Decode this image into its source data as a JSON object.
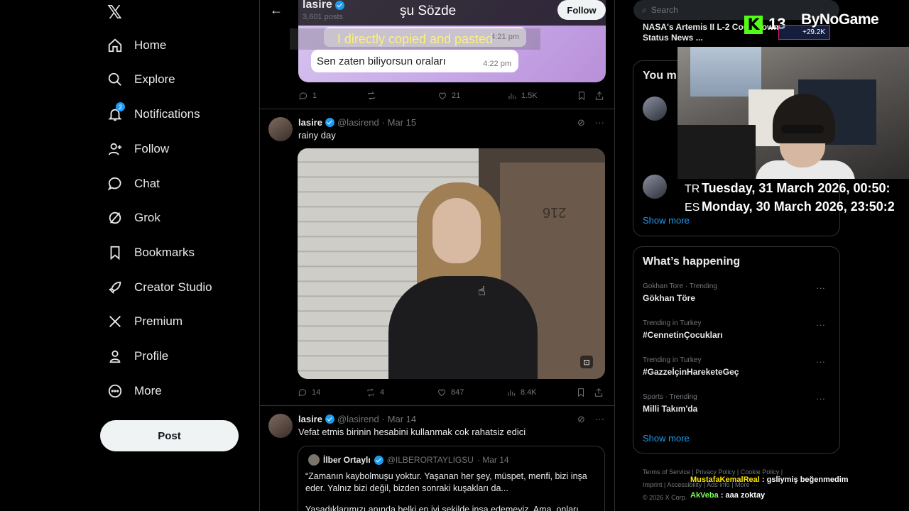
{
  "nav": {
    "logo": "𝕏",
    "items": [
      {
        "label": "Home"
      },
      {
        "label": "Explore"
      },
      {
        "label": "Notifications",
        "badge": "2"
      },
      {
        "label": "Follow"
      },
      {
        "label": "Chat"
      },
      {
        "label": "Grok"
      },
      {
        "label": "Bookmarks"
      },
      {
        "label": "Creator Studio"
      },
      {
        "label": "Premium"
      },
      {
        "label": "Profile"
      },
      {
        "label": "More"
      }
    ],
    "post_label": "Post"
  },
  "feed": {
    "header": {
      "name": "lasire",
      "posts_count": "3,601 posts",
      "follow_label": "Follow"
    },
    "overlay_subtitle": "şu Sözde",
    "overlay_caption": "I directly copied and pasted",
    "tweet1": {
      "chat_message": "Sen zaten biliyorsun oraları",
      "chat_time": "4:22 pm",
      "chat_time_top": "4:21 pm",
      "replies": "1",
      "reposts": "",
      "likes": "21",
      "views": "1.5K"
    },
    "tweet2": {
      "name": "lasire",
      "handle": "@lasirend",
      "date": "· Mar 15",
      "text": "rainy day",
      "door_number": "216",
      "replies": "14",
      "reposts": "4",
      "likes": "847",
      "views": "8.4K"
    },
    "tweet3": {
      "name": "lasire",
      "handle": "@lasirend",
      "date": "· Mar 14",
      "text": "Vefat etmis birinin hesabini kullanmak cok rahatsiz edici",
      "quote": {
        "name": "İlber Ortaylı",
        "handle": "@ILBERORTAYLIGSU",
        "date": "· Mar 14",
        "text": "“Zamanın kaybolmuşu yoktur. Yaşanan her şey, müspet, menfi, bizi inşa eder. Yalnız bizi değil, bizden sonraki kuşakları da...",
        "text2": "Yaşadıklarımızı anında belki en iyi şekilde inşa edemeyiz. Ama, onları"
      }
    }
  },
  "right": {
    "search_placeholder": "Search",
    "news_snippet": "NASA's Artemis II L-2 Countdown Status News ...",
    "who_to_follow_title": "You m",
    "who_to_follow_show_more": "Show more",
    "happening_title": "What’s happening",
    "trends": [
      {
        "context": "Gokhan Tore · Trending",
        "title": "Gökhan Töre"
      },
      {
        "context": "Trending in Turkey",
        "title": "#CennetinÇocukları"
      },
      {
        "context": "Trending in Turkey",
        "title": "#GazzeİçinHareketeGeç"
      },
      {
        "context": "Sports · Trending",
        "title": "Milli Takım'da"
      }
    ],
    "happening_show_more": "Show more",
    "footer": {
      "line1": "Terms of Service  |  Privacy Policy  |  Cookie Policy  |",
      "line2": "Imprint  |  Accessibility  |  Ads info  |  More ···",
      "line3": "© 2026 X Corp."
    }
  },
  "stream": {
    "kick_letter": "K",
    "viewer_count": "13",
    "brand": "ByNoGame",
    "sub_count": "+29.2K",
    "clock_tr_code": "TR",
    "clock_tr": "Tuesday, 31 March 2026, 00:50:",
    "clock_es_code": "ES",
    "clock_es": "Monday, 30 March 2026, 23:50:2",
    "chat": [
      {
        "user": "MustafaKemalReal",
        "msg": ": gsliymiş beğenmedim"
      },
      {
        "user": "AkVeba",
        "msg": ": aaa zoktay"
      }
    ]
  }
}
